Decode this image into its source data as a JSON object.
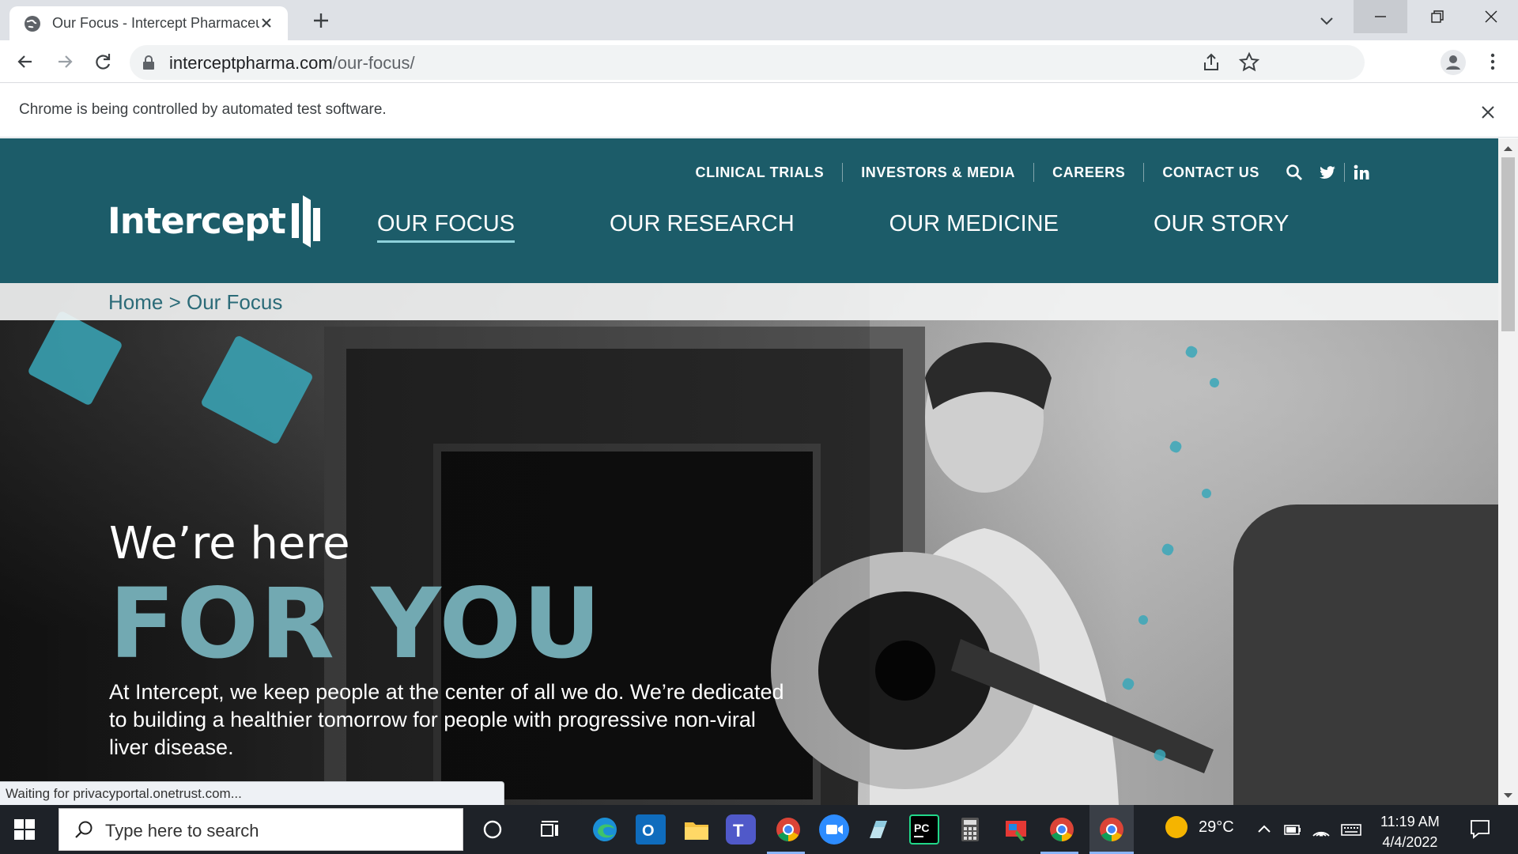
{
  "browser": {
    "tab_title": "Our Focus - Intercept Pharmaceu",
    "url_host": "interceptpharma.com",
    "url_path": "/our-focus/",
    "infobar_text": "Chrome is being controlled by automated test software.",
    "status_text": "Waiting for privacyportal.onetrust.com..."
  },
  "site": {
    "logo_text": "Intercept",
    "utility_nav": [
      "CLINICAL TRIALS",
      "INVESTORS & MEDIA",
      "CAREERS",
      "CONTACT US"
    ],
    "main_nav": [
      "OUR FOCUS",
      "OUR RESEARCH",
      "OUR MEDICINE",
      "OUR STORY"
    ],
    "active_nav": "OUR FOCUS",
    "breadcrumb": "Home > Our Focus",
    "hero": {
      "line1": "We’re here",
      "line2": "FOR YOU",
      "body": "At Intercept, we keep people at the center of all we do. We’re dedicated to building a healthier tomorrow for people with progressive non-viral liver disease."
    },
    "colors": {
      "header_bg": "#1c5c69",
      "accent_teal": "#72a9b2"
    }
  },
  "taskbar": {
    "search_placeholder": "Type here to search",
    "temperature": "29°C",
    "time": "11:19 AM",
    "date": "4/4/2022",
    "apps": [
      "cortana-icon",
      "task-view-icon",
      "edge-icon",
      "outlook-icon",
      "file-explorer-icon",
      "teams-icon",
      "chrome-icon",
      "zoom-icon",
      "app-icon",
      "pycharm-icon",
      "calculator-icon",
      "paint-icon",
      "chrome-icon",
      "chrome-active-icon"
    ]
  }
}
